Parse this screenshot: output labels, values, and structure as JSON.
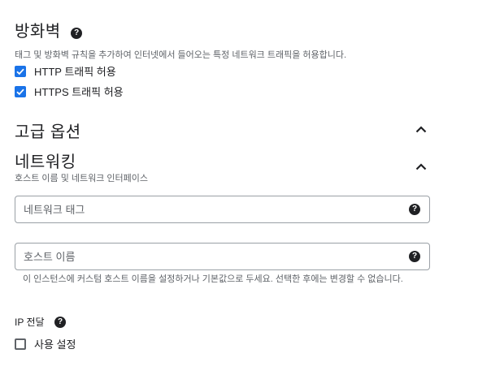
{
  "firewall": {
    "title": "방화벽",
    "help": "?",
    "description": "태그 및 방화벽 규칙을 추가하여 인터넷에서 들어오는 특정 네트워크 트래픽을 허용합니다.",
    "http_label": "HTTP 트래픽 허용",
    "http_checked": true,
    "https_label": "HTTPS 트래픽 허용",
    "https_checked": true
  },
  "advanced": {
    "title": "고급 옵션"
  },
  "networking": {
    "title": "네트워킹",
    "subtitle": "호스트 이름 및 네트워크 인터페이스",
    "network_tags_placeholder": "네트워크 태그",
    "hostname_placeholder": "호스트 이름",
    "hostname_hint": "이 인스턴스에 커스텀 호스트 이름을 설정하거나 기본값으로 두세요. 선택한 후에는 변경할 수 없습니다.",
    "ip_forwarding_label": "IP 전달",
    "enable_label": "사용 설정",
    "enable_checked": false
  },
  "icons": {
    "help": "help-circle-icon",
    "check": "checkmark-icon",
    "chevron": "chevron-up-icon"
  },
  "colors": {
    "accent": "#1a73e8",
    "text": "#202124",
    "secondary_text": "#5f6368",
    "border": "#9aa0a6"
  }
}
